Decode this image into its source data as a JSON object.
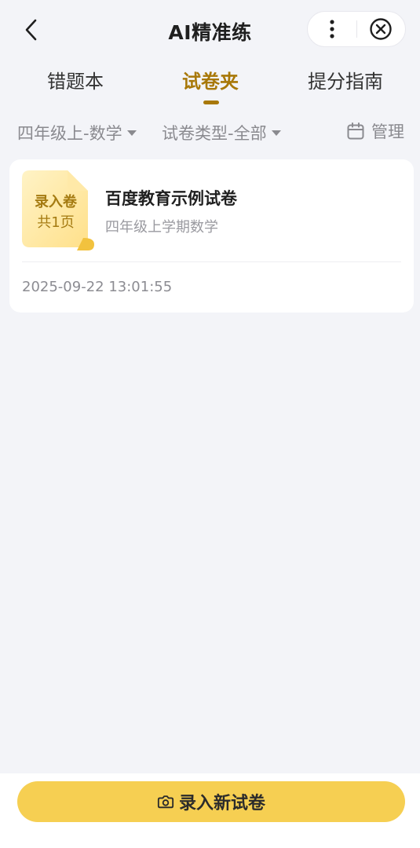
{
  "header": {
    "title": "AI精准练",
    "back_icon": "chevron-left-icon",
    "more_icon": "more-vertical-icon",
    "close_icon": "close-circle-icon"
  },
  "tabs": [
    {
      "label": "错题本",
      "active": false
    },
    {
      "label": "试卷夹",
      "active": true
    },
    {
      "label": "提分指南",
      "active": false
    }
  ],
  "filters": {
    "grade_subject": "四年级上-数学",
    "paper_type": "试卷类型-全部",
    "manage_label": "管理",
    "manage_icon": "calendar-icon"
  },
  "papers": [
    {
      "badge_line1": "录入卷",
      "badge_line2": "共1页",
      "title": "百度教育示例试卷",
      "subtitle": "四年级上学期数学",
      "timestamp": "2025-09-22 13:01:55"
    }
  ],
  "bottom": {
    "record_label": "录入新试卷",
    "record_icon": "camera-icon"
  },
  "colors": {
    "accent": "#a87808",
    "button": "#f6cf52",
    "background": "#f3f4f8"
  }
}
